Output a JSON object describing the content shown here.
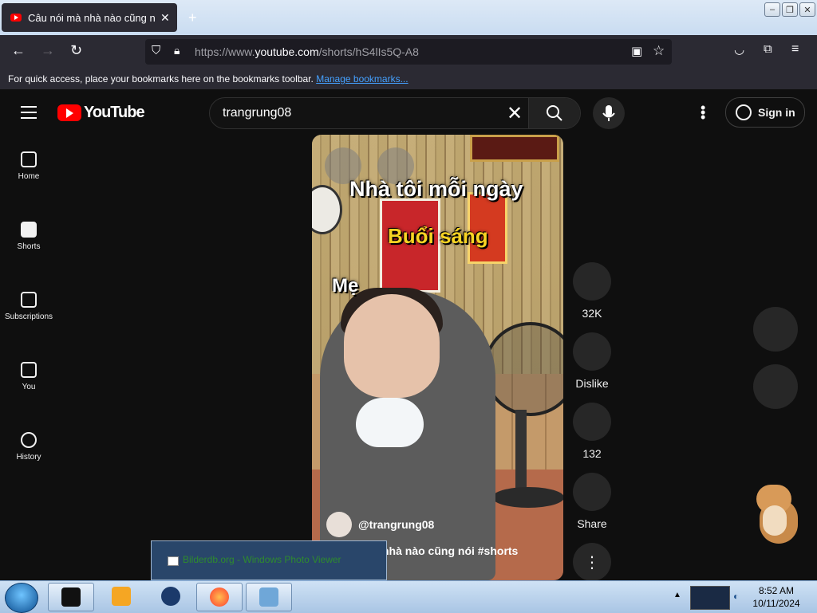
{
  "browser": {
    "tab_title": "Câu nói mà nhà nào cũng nói #",
    "tab_close": "✕",
    "new_tab": "+",
    "url_prefix": "https://www.",
    "url_domain": "youtube.com",
    "url_path": "/shorts/hS4lIs5Q-A8",
    "bookmarks_message": "For quick access, place your bookmarks here on the bookmarks toolbar.",
    "manage_bookmarks": "Manage bookmarks..."
  },
  "youtube": {
    "logo_text": "YouTube",
    "search_value": "trangrung08",
    "search_clear": "✕",
    "sign_in": "Sign in",
    "more_dots": "⋮",
    "sidebar": [
      {
        "label": "Home",
        "icon": "home-icon"
      },
      {
        "label": "Shorts",
        "icon": "shorts-icon"
      },
      {
        "label": "Subscriptions",
        "icon": "subscriptions-icon"
      },
      {
        "label": "You",
        "icon": "you-icon"
      },
      {
        "label": "History",
        "icon": "history-icon"
      }
    ],
    "video": {
      "caption_1": "Nhà tôi mỗi ngày",
      "caption_2": "Buổi sáng",
      "caption_3": "Mẹ",
      "channel": "@trangrung08",
      "description": "nhà nào cũng nói #shorts"
    },
    "actions": {
      "likes": "32K",
      "dislike": "Dislike",
      "comments": "132",
      "share": "Share",
      "more": "⋮"
    }
  },
  "taskbar": {
    "preview_title": "Bilderdb.org - Windows Photo Viewer",
    "time": "8:52 AM",
    "date": "10/11/2024"
  },
  "colors": {
    "youtube_red": "#ff0000",
    "youtube_bg": "#0f0f0f",
    "firefox_chrome": "#2b2a33",
    "link_blue": "#45a1ff",
    "caption_yellow": "#f9d423"
  }
}
